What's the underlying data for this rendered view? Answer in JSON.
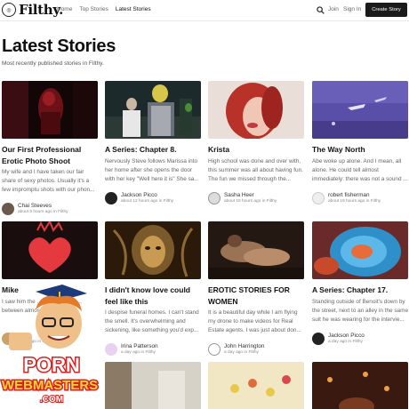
{
  "header": {
    "logo_text": "Filthy.",
    "nav": [
      "Home",
      "Top Stories",
      "Latest Stories"
    ],
    "active_nav": "Latest Stories",
    "join_label": "Join",
    "signin_label": "Sign In",
    "create_label": "Create Story"
  },
  "page": {
    "title": "Latest Stories",
    "subtitle": "Most recently published stories in Filthy."
  },
  "stories": [
    {
      "title": "Our First Professional Erotic Photo Shoot",
      "excerpt": "My wife and I have taken our fair share of sexy photos. Usually it's a few impromptu shots with our phon...",
      "author": "Chai Steeves",
      "meta": "about 5 hours ago in Filthy"
    },
    {
      "title": "A Series: Chapter 8.",
      "excerpt": "Nervously Steve follows Marissa into her home after she opens the door with her key \"Well here it is\" She sa...",
      "author": "Jackson Picco",
      "meta": "about 12 hours ago in Filthy"
    },
    {
      "title": "Krista",
      "excerpt": "High school was done and over with, this summer was all about having fun. The fun we missed through the...",
      "author": "Sasha Heer",
      "meta": "about 15 hours ago in Filthy"
    },
    {
      "title": "The Way North",
      "excerpt": "Abe woke up alone. And I mean, all alone. He could tell almost immediately: there was not a sound ...",
      "author": "robert fisherman",
      "meta": "about 19 hours ago in Filthy"
    },
    {
      "title": "Mike",
      "excerpt": "I saw him the ... the bar. He lo... between almost a...",
      "author": "Ma...",
      "meta": "a day ago in Filthy"
    },
    {
      "title": "I didn't know love could feel like this",
      "excerpt": "I despise funeral homes. I can't stand the smell. It's overwhelming and sickening, like something you'd exp...",
      "author": "Irina Patterson",
      "meta": "a day ago in Filthy"
    },
    {
      "title": "EROTIC STORIES FOR WOMEN",
      "excerpt": "It is a beautiful day while I am flying my drone to make videos for Real Estate agents. I was just about don...",
      "author": "John Harrington",
      "meta": "a day ago in Filthy"
    },
    {
      "title": "A Series: Chapter 17.",
      "excerpt": "Standing outside of Benoit's down by the street, next to an alley in the same suit he was wearing for the intervie...",
      "author": "Jackson Picco",
      "meta": "a day ago in Filthy"
    }
  ],
  "watermark": {
    "line1": "PORN",
    "line2": "WEBMASTERS",
    "line3": ".COM"
  },
  "colors": {
    "create_button_bg": "#1a1a1a",
    "text_primary": "#111111",
    "text_muted": "#666666"
  }
}
